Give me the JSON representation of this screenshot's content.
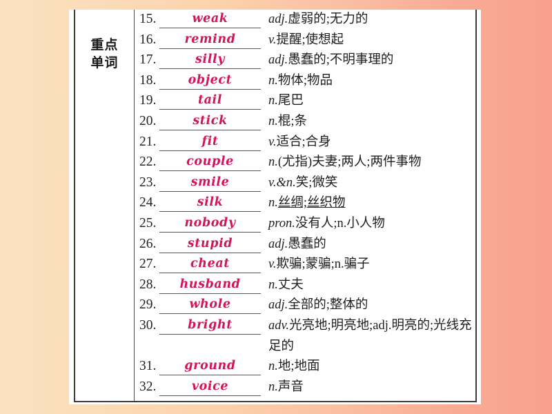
{
  "page": {
    "background_left_color": "#fbe0c0",
    "background_right_color": "#f8a18d",
    "paper_color": "#ffffff",
    "word_color": "#d4145a"
  },
  "table": {
    "category_label": "重点\n单词",
    "category_label_line1": "重点",
    "category_label_line2": "单词",
    "rows": [
      {
        "num": "15.",
        "word": "weak",
        "pos": "adj.",
        "meaning": "虚弱的;无力的"
      },
      {
        "num": "16.",
        "word": "remind",
        "pos": "v.",
        "meaning": "提醒;使想起"
      },
      {
        "num": "17.",
        "word": "silly",
        "pos": "adj.",
        "meaning": "愚蠢的;不明事理的"
      },
      {
        "num": "18.",
        "word": "object",
        "pos": "n.",
        "meaning": "物体;物品"
      },
      {
        "num": "19.",
        "word": "tail",
        "pos": "n.",
        "meaning": "尾巴"
      },
      {
        "num": "20.",
        "word": "stick",
        "pos": "n.",
        "meaning": "棍;条"
      },
      {
        "num": "21.",
        "word": "fit",
        "pos": "v.",
        "meaning": "适合;合身"
      },
      {
        "num": "22.",
        "word": "couple",
        "pos": "n.",
        "meaning": "(尤指)夫妻;两人;两件事物"
      },
      {
        "num": "23.",
        "word": "smile",
        "pos": "v.&n.",
        "meaning": "笑;微笑"
      },
      {
        "num": "24.",
        "word": "silk",
        "pos": "n.",
        "meaning": "丝绸;丝织物",
        "underlined": true
      },
      {
        "num": "25.",
        "word": "nobody",
        "pos": "pron.",
        "meaning": "没有人;n.小人物"
      },
      {
        "num": "26.",
        "word": "stupid",
        "pos": "adj.",
        "meaning": "愚蠢的"
      },
      {
        "num": "27.",
        "word": "cheat",
        "pos": "v.",
        "meaning": "欺骗;蒙骗;n.骗子"
      },
      {
        "num": "28.",
        "word": "husband",
        "pos": "n.",
        "meaning": "丈夫"
      },
      {
        "num": "29.",
        "word": "whole",
        "pos": "adj.",
        "meaning": "全部的;整体的"
      },
      {
        "num": "30.",
        "word": "bright",
        "pos": "adv.",
        "meaning": "光亮地;明亮地;adj.明亮的;光线充足的",
        "two_line": true
      },
      {
        "num": "31.",
        "word": "ground",
        "pos": "n.",
        "meaning": "地;地面"
      },
      {
        "num": "32.",
        "word": "voice",
        "pos": "n.",
        "meaning": "声音"
      }
    ]
  }
}
